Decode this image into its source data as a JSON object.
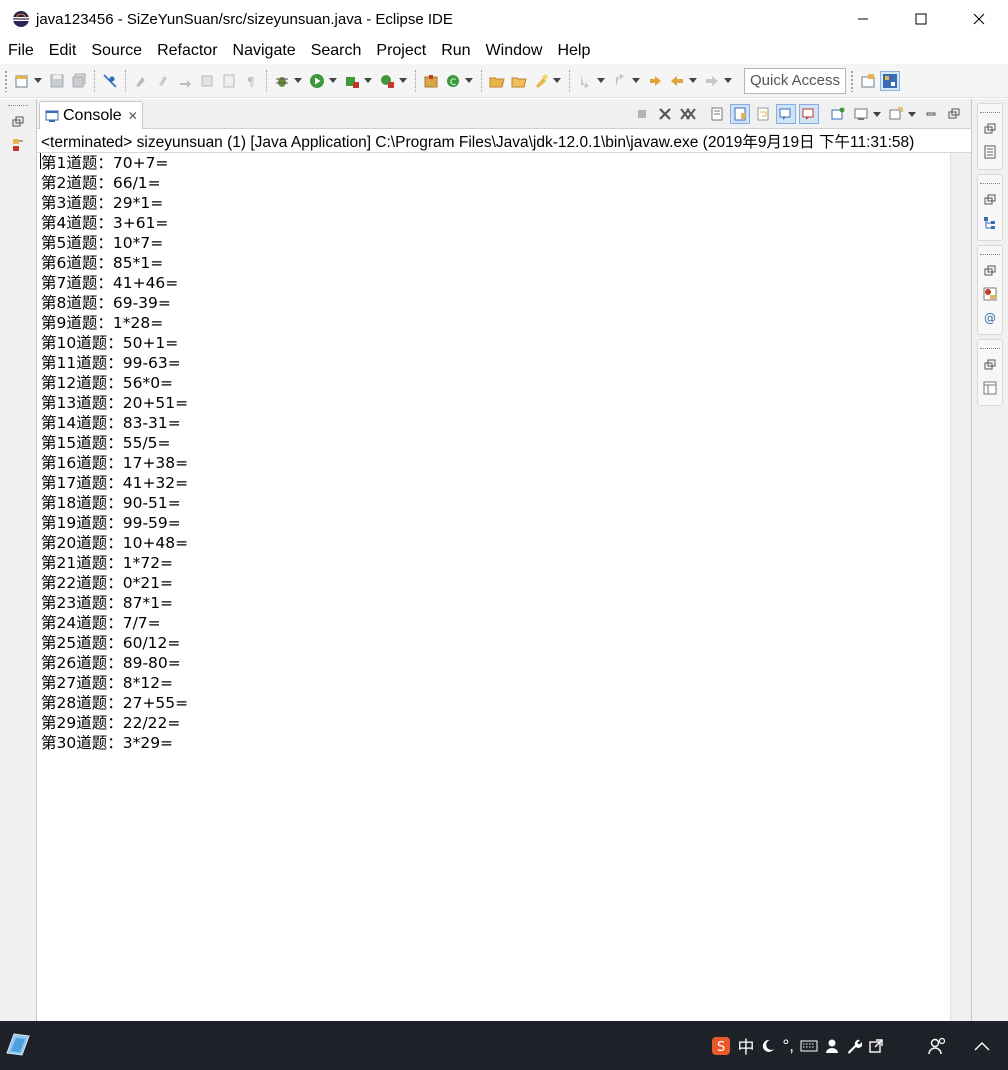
{
  "window": {
    "title": "java123456 - SiZeYunSuan/src/sizeyunsuan.java - Eclipse IDE",
    "minimize_icon": "minimize-icon",
    "maximize_icon": "maximize-icon",
    "close_icon": "close-icon"
  },
  "menu": [
    "File",
    "Edit",
    "Source",
    "Refactor",
    "Navigate",
    "Search",
    "Project",
    "Run",
    "Window",
    "Help"
  ],
  "toolbar": {
    "quick_access": "Quick Access"
  },
  "console": {
    "tab_label": "Console",
    "header": "<terminated> sizeyunsuan (1) [Java Application] C:\\Program Files\\Java\\jdk-12.0.1\\bin\\javaw.exe (2019年9月19日 下午11:31:58)",
    "lines": [
      "第1道题：70+7=",
      "第2道题：66/1=",
      "第3道题：29*1=",
      "第4道题：3+61=",
      "第5道题：10*7=",
      "第6道题：85*1=",
      "第7道题：41+46=",
      "第8道题：69-39=",
      "第9道题：1*28=",
      "第10道题：50+1=",
      "第11道题：99-63=",
      "第12道题：56*0=",
      "第13道题：20+51=",
      "第14道题：83-31=",
      "第15道题：55/5=",
      "第16道题：17+38=",
      "第17道题：41+32=",
      "第18道题：90-51=",
      "第19道题：99-59=",
      "第20道题：10+48=",
      "第21道题：1*72=",
      "第22道题：0*21=",
      "第23道题：87*1=",
      "第24道题：7/7=",
      "第25道题：60/12=",
      "第26道题：89-80=",
      "第27道题：8*12=",
      "第28道题：27+55=",
      "第29道题：22/22=",
      "第30道题：3*29="
    ]
  },
  "taskbar": {
    "ime_label": "中",
    "ime_punct": "°,"
  },
  "colors": {
    "taskbar_bg": "#1f2128",
    "toolbar_bg": "#f5f5f5",
    "trim_bg": "#f0f0f0",
    "accent_blue": "#2a6fbe"
  }
}
